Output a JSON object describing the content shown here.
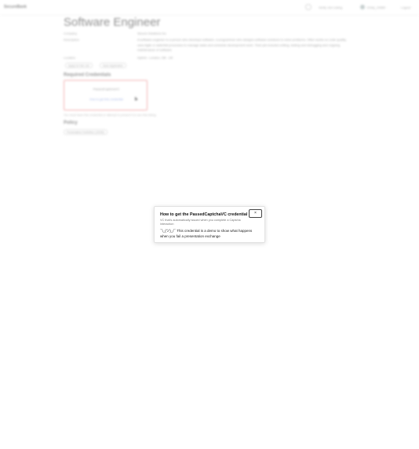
{
  "header": {
    "logo": "SecureBank",
    "verify_label": "Verify Job Listing",
    "user_label": "Emily_24589",
    "logout_label": "Logout"
  },
  "job": {
    "title": "Software Engineer",
    "company_label": "Company",
    "company_value": "Secure Solutions Inc",
    "description_label": "Description",
    "description_value": "A software engineer is a person who develops software, a programmer who designs software solutions to solve problems. Often works on code quality, uses Agile or waterfall processes to manage tasks and schedule development work. Their job includes writing, testing and debugging and ongoing maintenance of software.",
    "location_label": "Location",
    "location_value": "Hybrid - London, GB - UK",
    "tags": [
      "Apply for this Job",
      "Save Application"
    ]
  },
  "credentials": {
    "heading": "Required Credentials",
    "card_name": "PassedCaptchaVC",
    "card_link": "How to get this credential",
    "hint": "You must have this credential or attempt to present it to see this listing.",
    "policy_heading": "Policy",
    "policy_button": "Presentation Definition (JSON)"
  },
  "modal": {
    "title": "How to get the PassedCaptchaVC credential",
    "subtitle": "VC that's automatically issued when you complete a Captcha interaction",
    "body": "¯\\_(ツ)_/¯ This credential is a demo to show what happens when you fail a presentation exchange",
    "close_label": "×"
  }
}
